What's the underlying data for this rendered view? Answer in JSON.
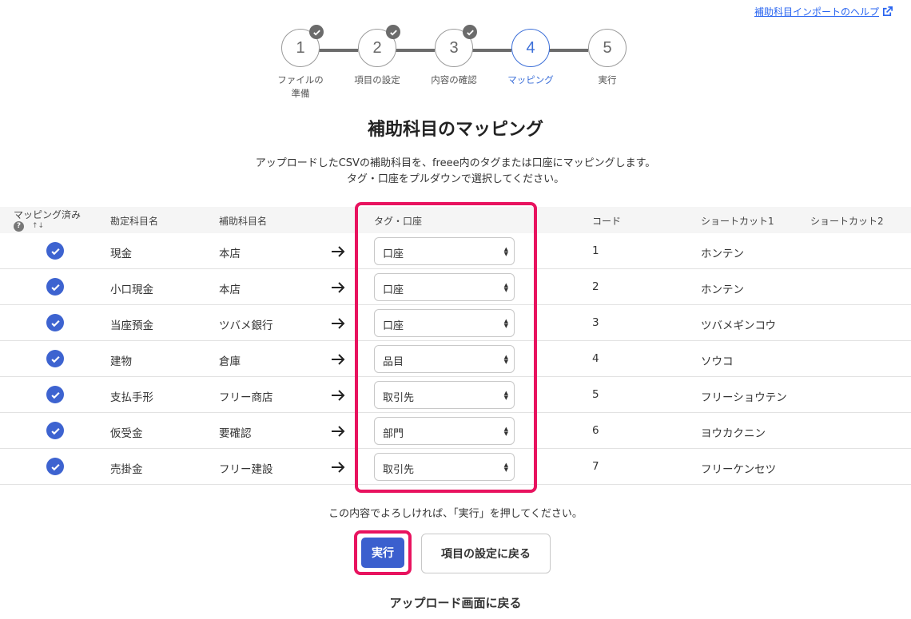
{
  "help_link": "補助科目インポートのヘルプ",
  "steps": [
    {
      "num": "1",
      "label": "ファイルの\n準備",
      "done": true
    },
    {
      "num": "2",
      "label": "項目の設定",
      "done": true
    },
    {
      "num": "3",
      "label": "内容の確認",
      "done": true
    },
    {
      "num": "4",
      "label": "マッピング",
      "done": false,
      "current": true
    },
    {
      "num": "5",
      "label": "実行",
      "done": false
    }
  ],
  "title": "補助科目のマッピング",
  "description_line1": "アップロードしたCSVの補助科目を、freee内のタグまたは口座にマッピングします。",
  "description_line2": "タグ・口座をプルダウンで選択してください。",
  "table": {
    "headers": {
      "mapped": "マッピング済み",
      "account": "勘定科目名",
      "sub_account": "補助科目名",
      "tag": "タグ・口座",
      "code": "コード",
      "shortcut1": "ショートカット1",
      "shortcut2": "ショートカット2"
    },
    "rows": [
      {
        "account": "現金",
        "sub_account": "本店",
        "tag": "口座",
        "code": "1",
        "shortcut1": "ホンテン",
        "shortcut2": ""
      },
      {
        "account": "小口現金",
        "sub_account": "本店",
        "tag": "口座",
        "code": "2",
        "shortcut1": "ホンテン",
        "shortcut2": ""
      },
      {
        "account": "当座預金",
        "sub_account": "ツバメ銀行",
        "tag": "口座",
        "code": "3",
        "shortcut1": "ツバメギンコウ",
        "shortcut2": ""
      },
      {
        "account": "建物",
        "sub_account": "倉庫",
        "tag": "品目",
        "code": "4",
        "shortcut1": "ソウコ",
        "shortcut2": ""
      },
      {
        "account": "支払手形",
        "sub_account": "フリー商店",
        "tag": "取引先",
        "code": "5",
        "shortcut1": "フリーショウテン",
        "shortcut2": ""
      },
      {
        "account": "仮受金",
        "sub_account": "要確認",
        "tag": "部門",
        "code": "6",
        "shortcut1": "ヨウカクニン",
        "shortcut2": ""
      },
      {
        "account": "売掛金",
        "sub_account": "フリー建設",
        "tag": "取引先",
        "code": "7",
        "shortcut1": "フリーケンセツ",
        "shortcut2": ""
      }
    ]
  },
  "confirm_text": "この内容でよろしければ、「実行」を押してください。",
  "run_button": "実行",
  "back_button": "項目の設定に戻る",
  "upload_back": "アップロード画面に戻る",
  "colors": {
    "accent": "#3b5fce",
    "highlight": "#e8135f",
    "link": "#2864f0"
  }
}
